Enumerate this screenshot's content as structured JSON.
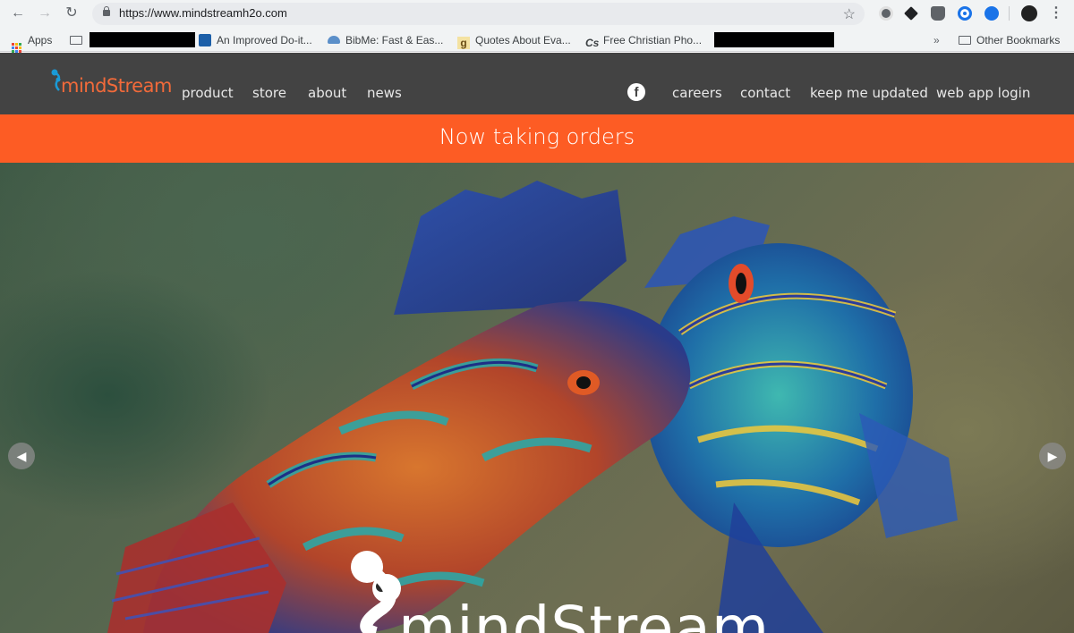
{
  "browser": {
    "url": "https://www.mindstreamh2o.com",
    "bookmarks": [
      {
        "label": "Apps"
      },
      {
        "label": "An Improved Do-it..."
      },
      {
        "label": "BibMe: Fast & Eas..."
      },
      {
        "label": "Quotes About Eva..."
      },
      {
        "label": "Free Christian Pho..."
      }
    ],
    "overflow_label": "»",
    "other_bookmarks": "Other Bookmarks"
  },
  "site": {
    "logo_text": "mindStream",
    "nav_left": [
      "product",
      "store",
      "about",
      "news"
    ],
    "nav_right": [
      "careers",
      "contact",
      "keep me updated",
      "web app login"
    ],
    "facebook_glyph": "f",
    "banner": "Now taking orders",
    "hero_logo_text": "mindStream"
  },
  "colors": {
    "nav_bg": "#434343",
    "banner_bg": "#fd5c24",
    "logo_accent": "#f26a3a"
  },
  "icons": [
    "back-arrow-icon",
    "forward-arrow-icon",
    "reload-icon",
    "lock-icon",
    "star-icon",
    "facebook-icon",
    "carousel-prev-icon",
    "carousel-next-icon"
  ]
}
